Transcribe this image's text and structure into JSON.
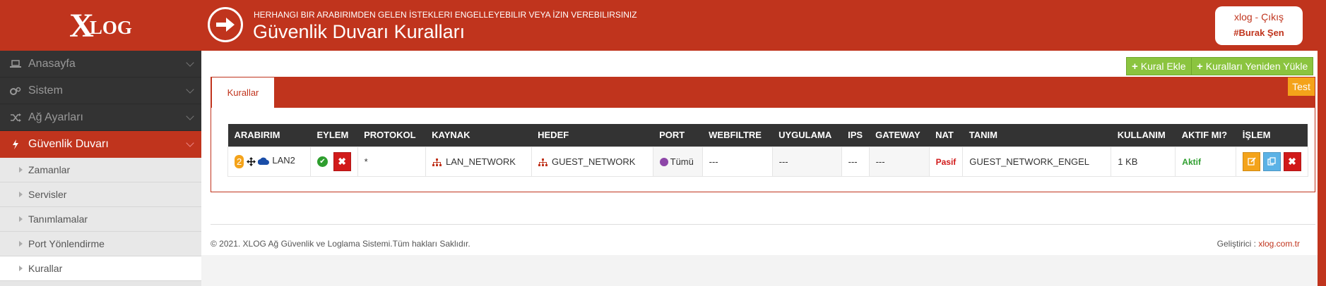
{
  "brand": {
    "logo_big": "X",
    "logo_small": "LOG"
  },
  "header": {
    "subtitle": "HERHANGI BIR ARABIRIMDEN GELEN İSTEKLERI ENGELLEYEBILIR VEYA İZIN VEREBILIRSINIZ",
    "title": "Güvenlik Duvarı Kuralları",
    "user": {
      "name": "xlog",
      "separator": " - ",
      "logout": "Çıkış",
      "tag": "#Burak Şen"
    }
  },
  "sidebar": {
    "items": [
      {
        "label": "Anasayfa",
        "icon": "laptop-icon"
      },
      {
        "label": "Sistem",
        "icon": "gears-icon"
      },
      {
        "label": "Ağ Ayarları",
        "icon": "shuffle-icon"
      },
      {
        "label": "Güvenlik Duvarı",
        "icon": "bolt-icon",
        "active": true
      }
    ],
    "subitems": [
      "Zamanlar",
      "Servisler",
      "Tanımlamalar",
      "Port Yönlendirme",
      "Kurallar"
    ],
    "current_sub": "Kurallar"
  },
  "toolbar": {
    "add_rule": "Kural Ekle",
    "reload_rules": "Kuralları Yeniden Yükle"
  },
  "panel": {
    "tab": "Kurallar",
    "test": "Test"
  },
  "table": {
    "headers": [
      "ARABIRIM",
      "EYLEM",
      "PROTOKOL",
      "KAYNAK",
      "HEDEF",
      "PORT",
      "WEBFILTRE",
      "UYGULAMA",
      "IPS",
      "GATEWAY",
      "NAT",
      "TANIM",
      "KULLANIM",
      "AKTIF MI?",
      "İŞLEM"
    ],
    "rows": [
      {
        "order": "2",
        "interface": "LAN2",
        "protocol": "*",
        "source": "LAN_NETWORK",
        "target": "GUEST_NETWORK",
        "port": "Tümü",
        "webfilter": "---",
        "application": "---",
        "ips": "---",
        "gateway": "---",
        "nat": "Pasif",
        "description": "GUEST_NETWORK_ENGEL",
        "usage": "1 KB",
        "active": "Aktif"
      }
    ]
  },
  "footer": {
    "copyright": "© 2021. XLOG Ağ Güvenlik ve Loglama Sistemi.Tüm hakları Saklıdır.",
    "dev_label": "Geliştirici : ",
    "dev_link": "xlog.com.tr"
  },
  "colors": {
    "brand_red": "#c0341d",
    "green": "#8bc43f",
    "orange": "#f4a31a",
    "dark": "#333333"
  }
}
